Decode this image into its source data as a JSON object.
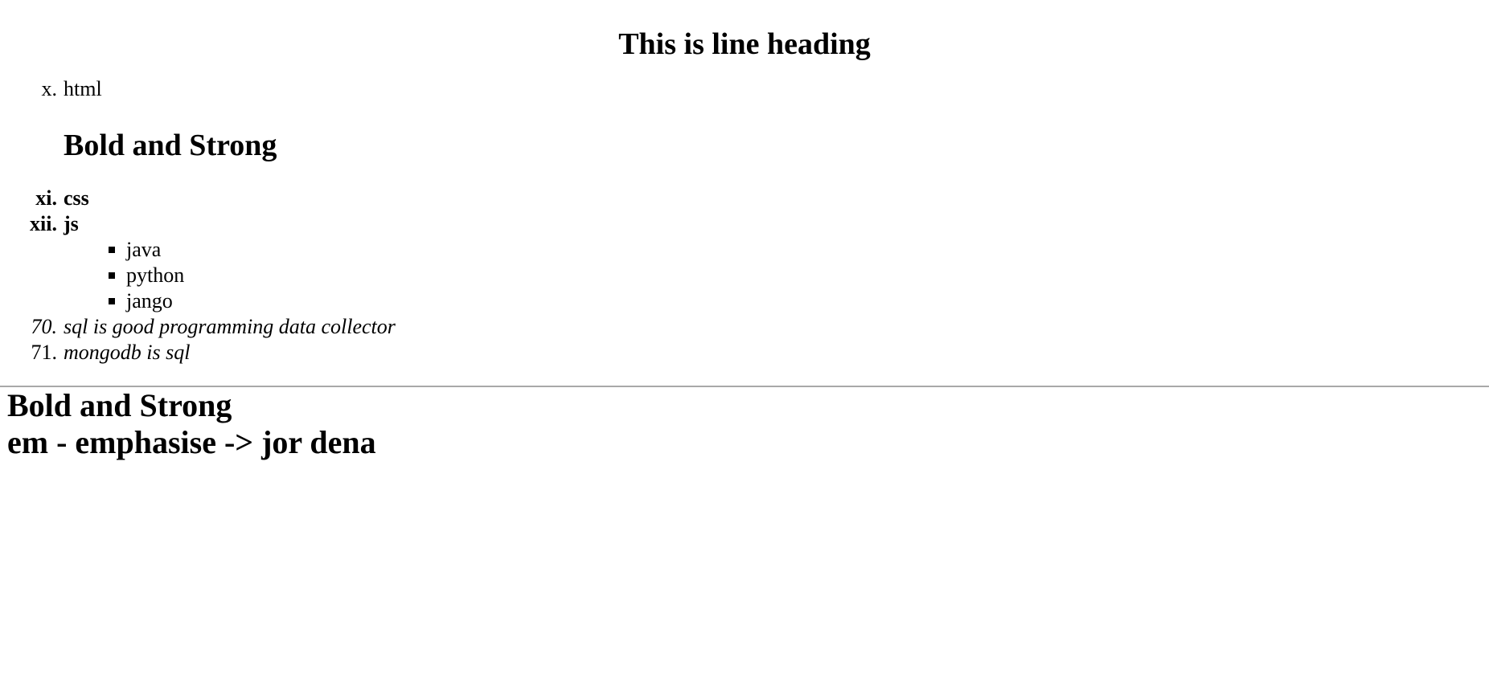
{
  "page_title": "This is line heading",
  "list_top": {
    "item_x": {
      "marker": "x.",
      "text": "html"
    },
    "inline_heading": "Bold and Strong",
    "item_xi": {
      "marker": "xi.",
      "text": "css"
    },
    "item_xii": {
      "marker": "xii.",
      "text": "js"
    },
    "nested": [
      "java",
      "python",
      "jango"
    ],
    "item_70": {
      "marker": "70.",
      "text": "sql is good programming data collector"
    },
    "item_71": {
      "marker": "71.",
      "text": "mongodb is sql"
    }
  },
  "bottom": {
    "heading_1": "Bold and Strong",
    "heading_2": "em - emphasise -> jor dena"
  }
}
